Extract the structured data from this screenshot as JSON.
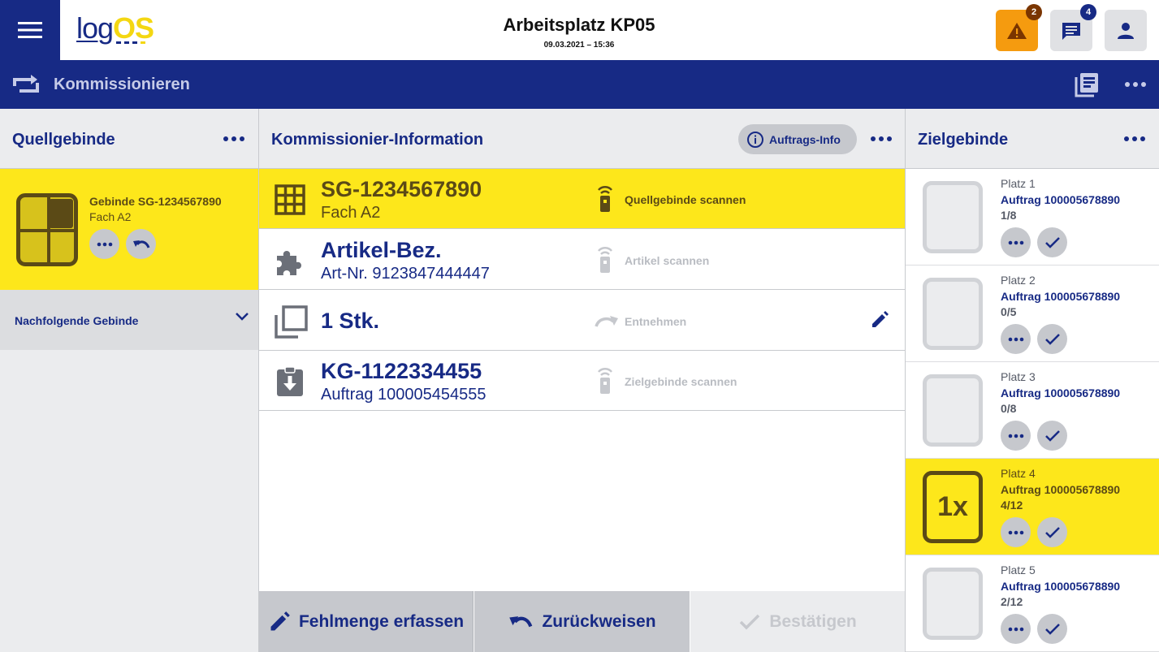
{
  "app": {
    "logo_part1": "log",
    "logo_part2": "OS",
    "title": "Arbeitsplatz KP05",
    "datetime": "09.03.2021 – 15:36",
    "alerts_count": "2",
    "messages_count": "4"
  },
  "nav": {
    "title": "Kommissionieren"
  },
  "left": {
    "title": "Quellgebinde",
    "source": {
      "name": "Gebinde SG-1234567890",
      "fach": "Fach A2"
    },
    "next_label": "Nachfolgende Gebinde"
  },
  "mid": {
    "title": "Kommissionier-Information",
    "info_button": "Auftrags-Info",
    "rows": [
      {
        "main": "SG-1234567890",
        "sub": "Fach A2",
        "action": "Quellgebinde scannen",
        "icon": "grid-icon"
      },
      {
        "main": "Artikel-Bez.",
        "sub": "Art-Nr. 9123847444447",
        "action": "Artikel scannen",
        "icon": "puzzle-icon"
      },
      {
        "main": "1 Stk.",
        "sub": "",
        "action": "Entnehmen",
        "icon": "copy-icon"
      },
      {
        "main": "KG-1122334455",
        "sub": "Auftrag 100005454555",
        "action": "Zielgebinde scannen",
        "icon": "clipboard-download-icon"
      }
    ],
    "buttons": {
      "shortage": "Fehlmenge erfassen",
      "reject": "Zurückweisen",
      "confirm": "Bestätigen"
    }
  },
  "right": {
    "title": "Zielgebinde",
    "slots": [
      {
        "place": "Platz 1",
        "order": "Auftrag 100005678890",
        "count": "1/8",
        "badge": ""
      },
      {
        "place": "Platz 2",
        "order": "Auftrag 100005678890",
        "count": "0/5",
        "badge": ""
      },
      {
        "place": "Platz 3",
        "order": "Auftrag 100005678890",
        "count": "0/8",
        "badge": ""
      },
      {
        "place": "Platz 4",
        "order": "Auftrag 100005678890",
        "count": "4/12",
        "badge": "1x"
      },
      {
        "place": "Platz 5",
        "order": "Auftrag 100005678890",
        "count": "2/12",
        "badge": ""
      }
    ]
  },
  "colors": {
    "navy": "#172a85",
    "yellow": "#fde71b",
    "orange": "#f59b0f",
    "brown": "#5b4a16",
    "grey": "#c6c8cd"
  }
}
